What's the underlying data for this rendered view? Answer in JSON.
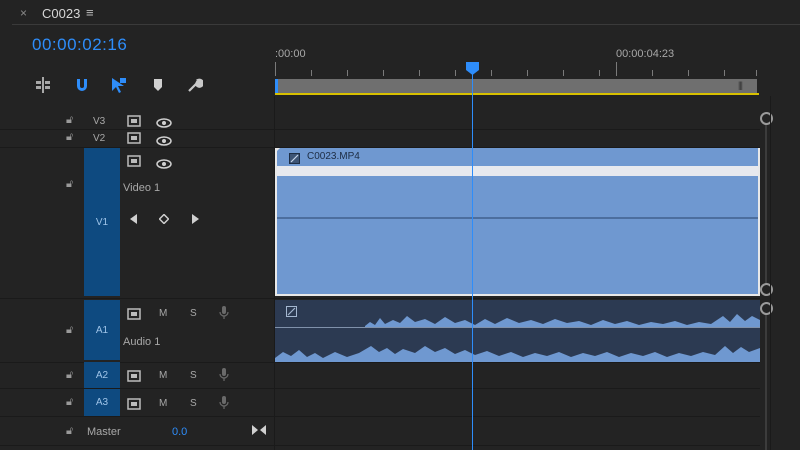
{
  "tab": {
    "close_glyph": "×",
    "title": "C0023",
    "menu_glyph": "≡"
  },
  "timecode": "00:00:02:16",
  "ruler": {
    "start_label": ":00:00",
    "end_label": "00:00:04:23"
  },
  "tools": [
    {
      "name": "insert-overwrite-icon",
      "active": false
    },
    {
      "name": "snap-magnet-icon",
      "active": true
    },
    {
      "name": "linked-selection-icon",
      "active": true
    },
    {
      "name": "add-marker-icon",
      "active": false
    },
    {
      "name": "wrench-settings-icon",
      "active": false
    }
  ],
  "tracks": {
    "v3": {
      "label": "V3"
    },
    "v2": {
      "label": "V2"
    },
    "v1": {
      "label": "V1",
      "name": "Video 1"
    },
    "a1": {
      "label": "A1",
      "name": "Audio 1",
      "m": "M",
      "s": "S"
    },
    "a2": {
      "label": "A2",
      "m": "M",
      "s": "S"
    },
    "a3": {
      "label": "A3",
      "m": "M",
      "s": "S"
    },
    "master": {
      "label": "Master",
      "value": "0.0"
    }
  },
  "clips": {
    "video_name": "C0023.MP4"
  },
  "colors": {
    "accent": "#2e8dfa",
    "clip_video": "#6f98d0",
    "clip_audio": "#2c3a52",
    "target_blue": "#0e4a80",
    "work_area_yellow": "#d8c000"
  }
}
